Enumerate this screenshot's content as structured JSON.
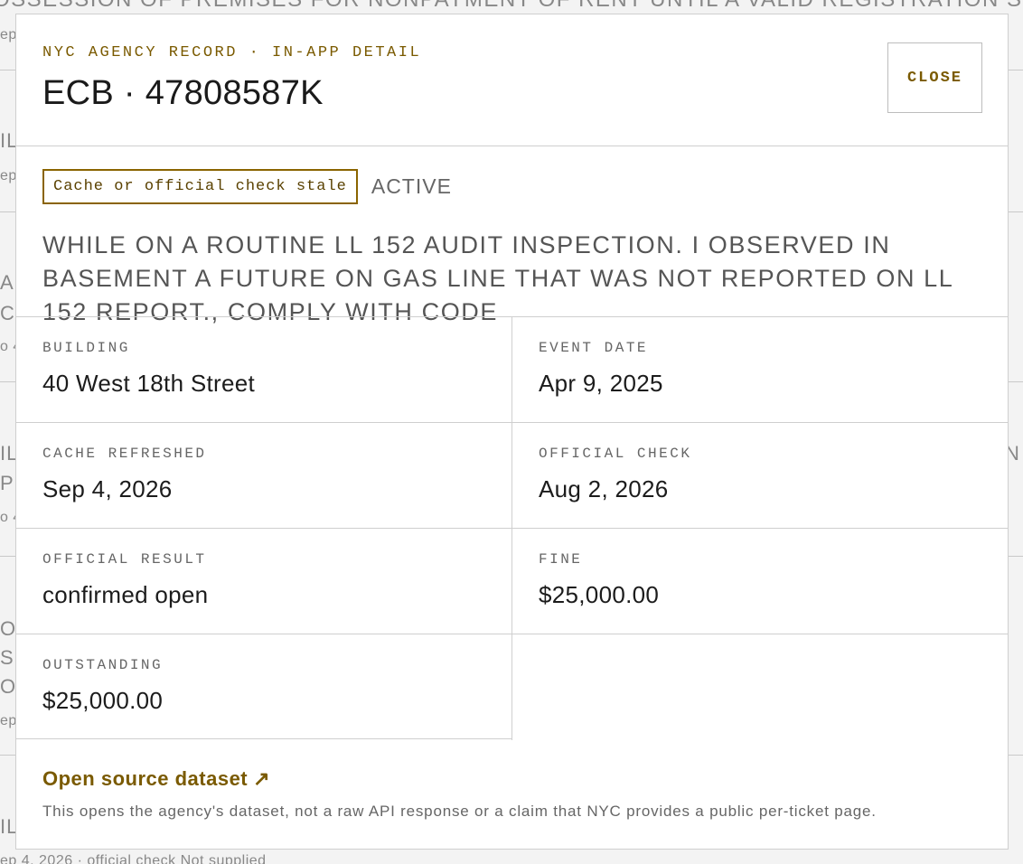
{
  "background": {
    "top_text": "OSSESSION OF PREMISES FOR NONPAYMENT OF RENT UNTIL A VALID REGISTRATION STATEMENT IS FILED.",
    "fragments": [
      "ep",
      "ep",
      "IL",
      "AL",
      "C",
      "o 4",
      "IL",
      "PL",
      "o 4",
      "N",
      "OV",
      "S",
      "OS",
      "ep",
      "IL",
      "ep 4, 2026 · official check Not supplied"
    ]
  },
  "modal": {
    "eyebrow": "NYC AGENCY RECORD · IN-APP DETAIL",
    "title": "ECB · 47808587K",
    "close_label": "CLOSE",
    "stale_badge": "Cache or official check stale",
    "status": "ACTIVE",
    "description": "WHILE ON A ROUTINE LL 152 AUDIT INSPECTION. I OBSERVED IN BASEMENT A FUTURE ON GAS LINE THAT WAS NOT REPORTED ON LL 152 REPORT., COMPLY WITH CODE",
    "fields": {
      "building_label": "BUILDING",
      "building_value": "40 West 18th Street",
      "event_date_label": "EVENT DATE",
      "event_date_value": "Apr 9, 2025",
      "cache_refreshed_label": "CACHE REFRESHED",
      "cache_refreshed_value": "Sep 4, 2026",
      "official_check_label": "OFFICIAL CHECK",
      "official_check_value": "Aug 2, 2026",
      "official_result_label": "OFFICIAL RESULT",
      "official_result_value": "confirmed open",
      "fine_label": "FINE",
      "fine_value": "$25,000.00",
      "outstanding_label": "OUTSTANDING",
      "outstanding_value": "$25,000.00"
    },
    "dataset_link": "Open source dataset",
    "dataset_link_icon": "↗",
    "disclaimer": "This opens the agency's dataset, not a raw API response or a claim that NYC provides a public per-ticket page."
  },
  "colors": {
    "accent": "#7a5a00",
    "badge_border": "#8a6400",
    "background": "#f3f3f3"
  }
}
